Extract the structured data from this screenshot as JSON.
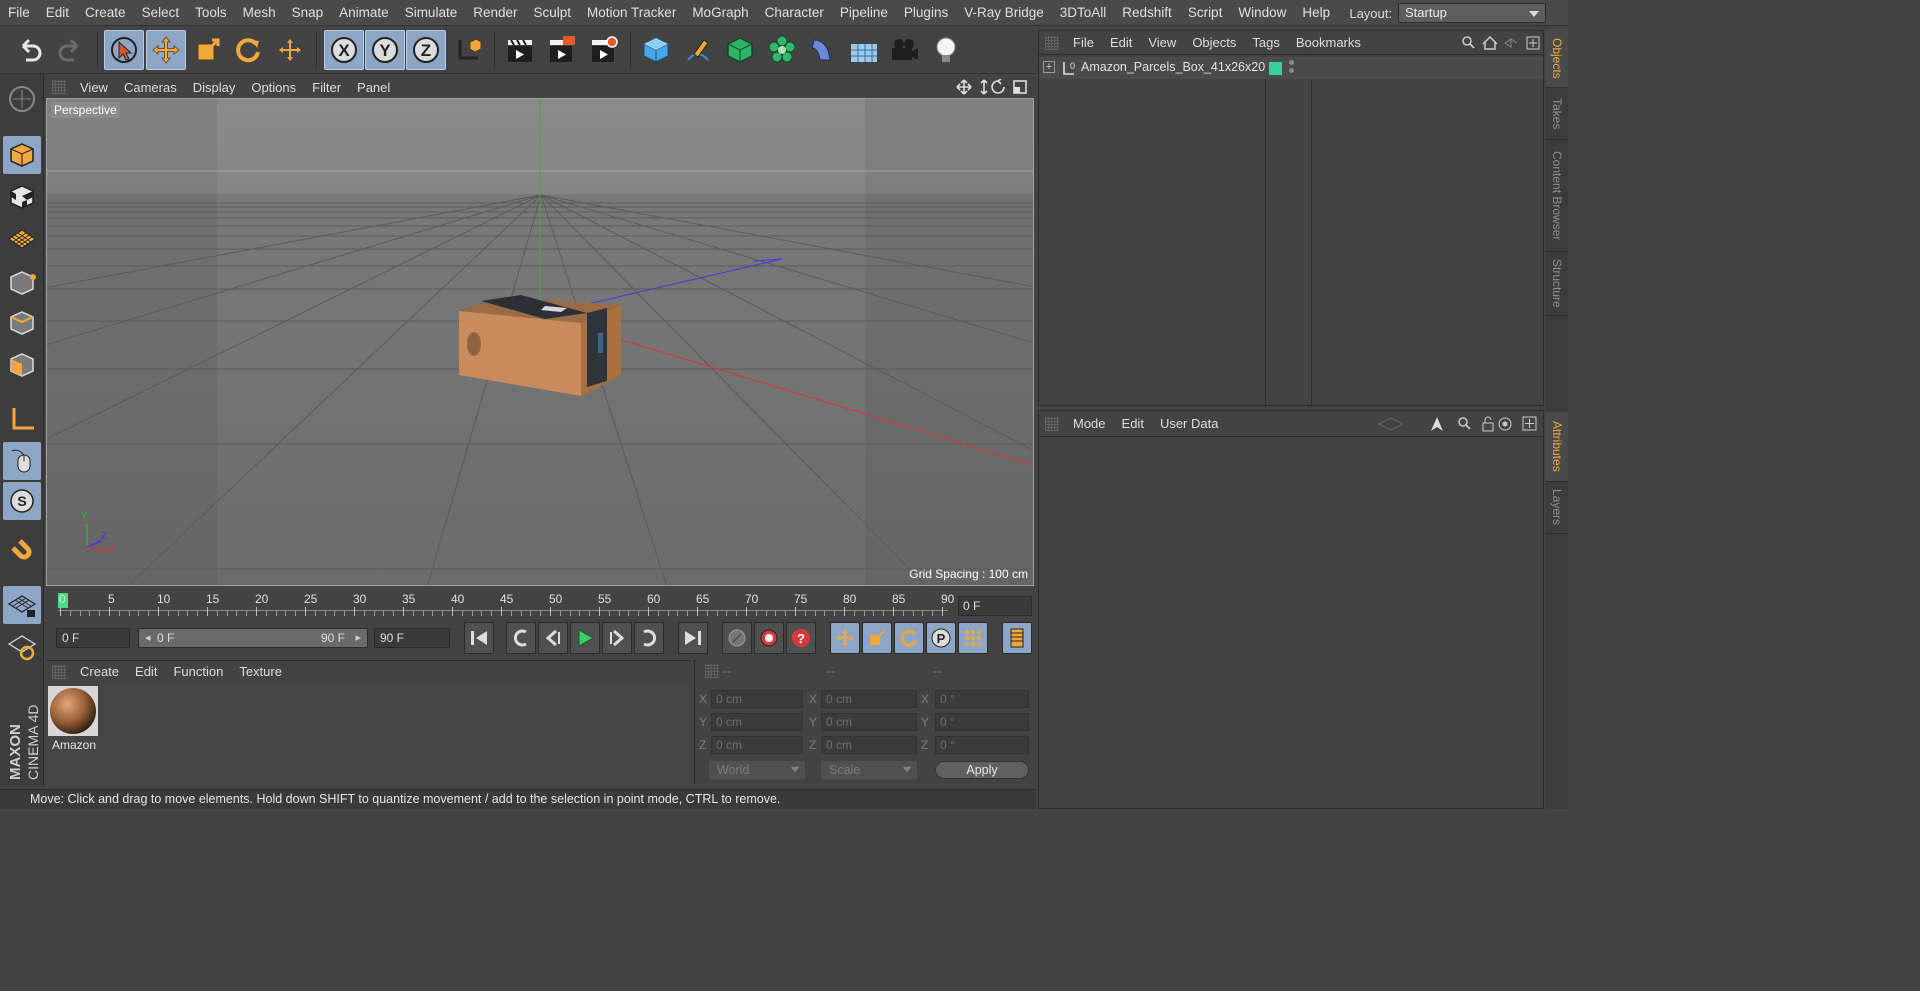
{
  "menubar": {
    "items": [
      "File",
      "Edit",
      "Create",
      "Select",
      "Tools",
      "Mesh",
      "Snap",
      "Animate",
      "Simulate",
      "Render",
      "Sculpt",
      "Motion Tracker",
      "MoGraph",
      "Character",
      "Pipeline",
      "Plugins",
      "V-Ray Bridge",
      "3DToAll",
      "Redshift",
      "Script",
      "Window",
      "Help"
    ],
    "layout_label": "Layout:",
    "layout_value": "Startup"
  },
  "viewport": {
    "menu": [
      "View",
      "Cameras",
      "Display",
      "Options",
      "Filter",
      "Panel"
    ],
    "label": "Perspective",
    "grid_spacing": "Grid Spacing : 100 cm",
    "axis_y": "Y",
    "axis_z": "Z",
    "axis_x": "X"
  },
  "timeline": {
    "ticks": [
      "0",
      "5",
      "10",
      "15",
      "20",
      "25",
      "30",
      "35",
      "40",
      "45",
      "50",
      "55",
      "60",
      "65",
      "70",
      "75",
      "80",
      "85",
      "90"
    ],
    "current_frame": "0 F",
    "start_field": "0 F",
    "range_start": "0 F",
    "range_end": "90 F",
    "end_field": "90 F"
  },
  "materials": {
    "menu": [
      "Create",
      "Edit",
      "Function",
      "Texture"
    ],
    "items": [
      {
        "name": "Amazon"
      }
    ]
  },
  "coordinates": {
    "headers": [
      "--",
      "--",
      "--"
    ],
    "rows": [
      {
        "axis": "X",
        "pos": "0 cm",
        "size": "0 cm",
        "rot": "0 °"
      },
      {
        "axis": "Y",
        "pos": "0 cm",
        "size": "0 cm",
        "rot": "0 °"
      },
      {
        "axis": "Z",
        "pos": "0 cm",
        "size": "0 cm",
        "rot": "0 °"
      }
    ],
    "mode_select": "World",
    "scale_select": "Scale",
    "apply": "Apply"
  },
  "objects": {
    "menu": [
      "File",
      "Edit",
      "View",
      "Objects",
      "Tags",
      "Bookmarks"
    ],
    "tree": [
      {
        "name": "Amazon_Parcels_Box_41x26x20",
        "layer_color": "#2fd39b"
      }
    ]
  },
  "attributes": {
    "menu": [
      "Mode",
      "Edit",
      "User Data"
    ]
  },
  "right_tabs": {
    "top": [
      "Objects",
      "Takes",
      "Content Browser",
      "Structure"
    ],
    "bottom": [
      "Attributes",
      "Layers"
    ]
  },
  "status": "Move: Click and drag to move elements. Hold down SHIFT to quantize movement / add to the selection in point mode, CTRL to remove.",
  "brand": {
    "line1": "MAXON",
    "line2": "CINEMA 4D"
  },
  "colors": {
    "accent": "#8ea6c6",
    "orange": "#f2a83c",
    "layer_green": "#2fd39b"
  }
}
